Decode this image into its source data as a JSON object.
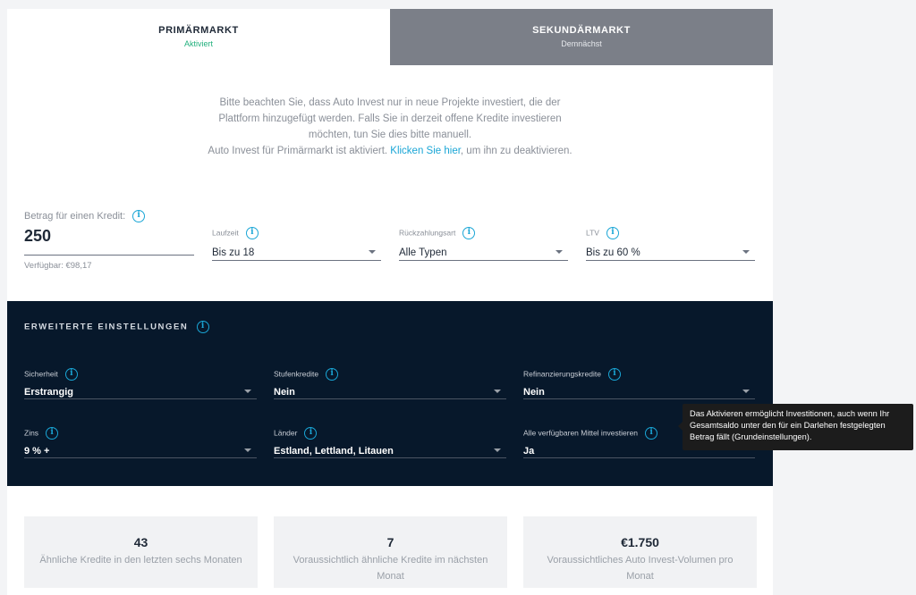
{
  "tabs": [
    {
      "title": "PRIMÄRMARKT",
      "status": "Aktiviert"
    },
    {
      "title": "SEKUNDÄRMARKT",
      "status": "Demnächst"
    }
  ],
  "notice": {
    "line1": "Bitte beachten Sie, dass Auto Invest nur in neue Projekte investiert, die der Plattform hinzugefügt werden. Falls Sie in derzeit offene Kredite investieren möchten, tun Sie dies bitte manuell.",
    "line2_pre": "Auto Invest für Primärmarkt ist aktiviert. ",
    "link": "Klicken Sie hier",
    "line2_post": ", um ihn zu deaktivieren."
  },
  "amount": {
    "label": "Betrag für einen Kredit:",
    "value": "250",
    "available": "Verfügbar: €98,17"
  },
  "filters": {
    "term": {
      "label": "Laufzeit",
      "value": "Bis zu 18"
    },
    "repayment": {
      "label": "Rückzahlungsart",
      "value": "Alle Typen"
    },
    "ltv": {
      "label": "LTV",
      "value": "Bis zu 60 %"
    }
  },
  "advanced": {
    "title": "ERWEITERTE EINSTELLUNGEN",
    "security": {
      "label": "Sicherheit",
      "value": "Erstrangig"
    },
    "tiered": {
      "label": "Stufenkredite",
      "value": "Nein"
    },
    "refinancing": {
      "label": "Refinanzierungskredite",
      "value": "Nein"
    },
    "interest": {
      "label": "Zins",
      "value": "9 % +"
    },
    "countries": {
      "label": "Länder",
      "value": "Estland, Lettland, Litauen"
    },
    "invest_all": {
      "label": "Alle verfügbaren Mittel investieren",
      "value": "Ja"
    }
  },
  "stats": [
    {
      "value": "43",
      "desc": "Ähnliche Kredite in den letzten sechs Monaten"
    },
    {
      "value": "7",
      "desc": "Voraussichtlich ähnliche Kredite im nächsten Monat"
    },
    {
      "value": "€1.750",
      "desc": "Voraussichtliches Auto Invest-Volumen pro Monat"
    }
  ],
  "tooltip": {
    "text": "Das Aktivieren ermöglicht Investitionen, auch wenn Ihr Gesamtsaldo unter den für ein Darlehen festgelegten Betrag fällt (Grundeinstellungen)."
  },
  "icons": {
    "info": "info-icon",
    "caret": "chevron-down-icon"
  },
  "colors": {
    "accent": "#1aa6d6",
    "active_status": "#22b07d",
    "dark_bg": "#07182b",
    "inactive_tab": "#7b7f88"
  }
}
